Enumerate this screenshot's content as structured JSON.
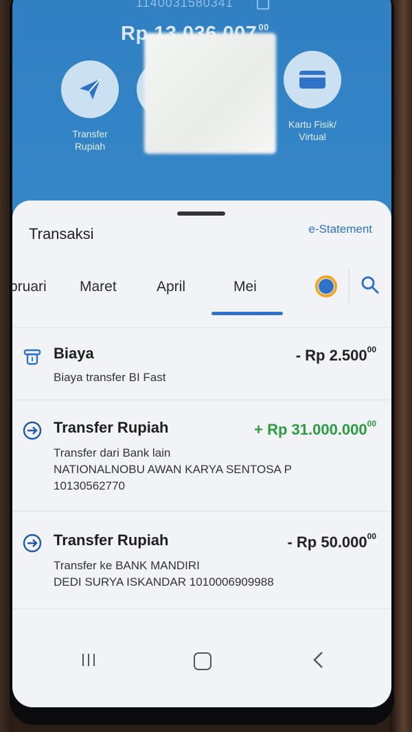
{
  "header": {
    "account_number": "1140031580341",
    "balance_main": "Rp 13.036.007",
    "balance_decimals": "00"
  },
  "actions": [
    {
      "label_line1": "Transfer",
      "label_line2": "Rupiah",
      "icon": "paper-plane-icon"
    },
    {
      "label_line1": "",
      "label_line2": "",
      "icon": "hidden"
    },
    {
      "label_line1": "",
      "label_line2": "",
      "icon": "hidden"
    },
    {
      "label_line1": "Kartu Fisik/",
      "label_line2": "Virtual",
      "icon": "card-icon"
    }
  ],
  "sheet": {
    "title": "Transaksi",
    "estatement_label": "e-Statement",
    "tabs": [
      "bruari",
      "Maret",
      "April",
      "Mei"
    ],
    "active_tab": "Mei"
  },
  "transactions": [
    {
      "icon": "fee-icon",
      "title": "Biaya",
      "amount": "- Rp 2.500",
      "amount_decimals": "00",
      "type": "debit",
      "lines": [
        "Biaya transfer BI Fast"
      ]
    },
    {
      "icon": "transfer-in-icon",
      "title": "Transfer Rupiah",
      "amount": "+ Rp 31.000.000",
      "amount_decimals": "00",
      "type": "credit",
      "lines": [
        "Transfer dari Bank lain",
        "NATIONALNOBU AWAN KARYA SENTOSA P",
        "10130562770"
      ]
    },
    {
      "icon": "transfer-out-icon",
      "title": "Transfer Rupiah",
      "amount": "- Rp 50.000",
      "amount_decimals": "00",
      "type": "debit",
      "lines": [
        "Transfer ke BANK MANDIRI",
        "DEDI SURYA ISKANDAR 1010006909988"
      ]
    }
  ],
  "colors": {
    "header_blue": "#2f7fc2",
    "accent": "#2f73c9",
    "credit_green": "#2a9d3e"
  }
}
